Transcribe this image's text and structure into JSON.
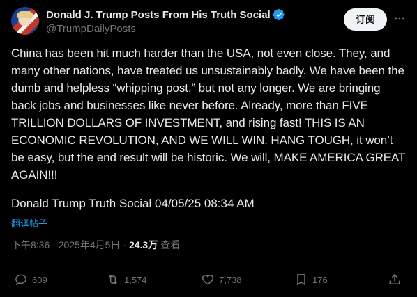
{
  "post": {
    "author_name": "Donald J. Trump Posts From His Truth Social",
    "handle": "@TrumpDailyPosts",
    "subscribe_label": "订阅",
    "text": "China has been hit much harder than the USA, not even close. They, and many other nations, have treated us unsustainably badly. We have been the dumb and helpless “whipping post,” but not any longer. We are bringing back jobs and businesses like never before. Already, more than FIVE TRILLION DOLLARS OF INVESTMENT, and rising fast! THIS IS AN ECONOMIC REVOLUTION, AND WE WILL WIN. HANG TOUGH, it won’t be easy, but the end result will be historic. We will, MAKE AMERICA GREAT AGAIN!!!",
    "attribution": "Donald Trump Truth Social 04/05/25 08:34 AM",
    "translate_label": "翻译帖子",
    "timestamp": "下午8:36 · 2025年4月5日 ·",
    "views_count": "24.3万",
    "views_label": "查看"
  },
  "actions": {
    "replies": "609",
    "reposts": "1,574",
    "likes": "7,738",
    "bookmarks": "176"
  },
  "colors": {
    "background": "#000000",
    "accent": "#1d9bf0",
    "muted": "#71767b"
  },
  "icons": [
    "verified-badge-icon",
    "more-options-icon",
    "reply-icon",
    "repost-icon",
    "like-icon",
    "bookmark-icon",
    "share-icon"
  ]
}
